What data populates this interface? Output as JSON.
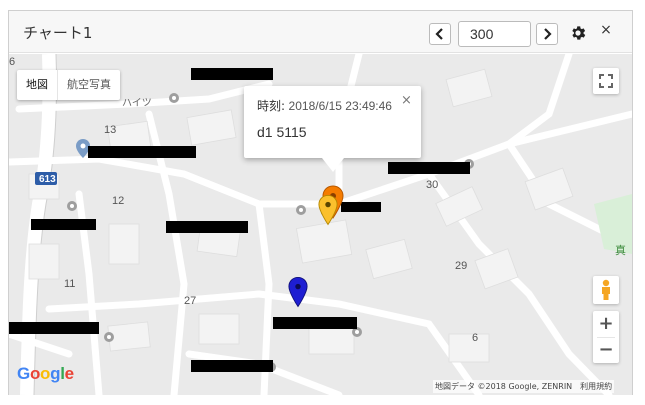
{
  "header": {
    "title": "チャート1",
    "prev_label": "<",
    "next_label": ">",
    "count_value": "300",
    "settings_icon": "gear-icon",
    "close_label": "×"
  },
  "map": {
    "type_map": "地図",
    "type_satellite": "航空写真",
    "labels": {
      "l6": "6",
      "l13": "13",
      "l12": "12",
      "l11": "11",
      "l27": "27",
      "l30": "30",
      "l29": "29",
      "l6b": "6",
      "road": "613",
      "haitsu": "ハイツ",
      "ku": "ク",
      "ma": "真"
    },
    "zoom_in": "+",
    "zoom_out": "−",
    "google": [
      "G",
      "o",
      "o",
      "g",
      "l",
      "e"
    ],
    "google_colors": [
      "#4285F4",
      "#EA4335",
      "#FBBC05",
      "#4285F4",
      "#34A853",
      "#EA4335"
    ],
    "attribution": "地図データ ©2018 Google, ZENRIN　利用規約"
  },
  "infowindow": {
    "time_key": "時刻:",
    "time_value": "2018/6/15 23:49:46",
    "value": "d1 5115",
    "close": "×"
  },
  "markers": [
    {
      "color": "#f57c00",
      "name": "orange"
    },
    {
      "color": "#fbc02d",
      "name": "yellow"
    },
    {
      "color": "#1e1ed2",
      "name": "blue"
    }
  ]
}
